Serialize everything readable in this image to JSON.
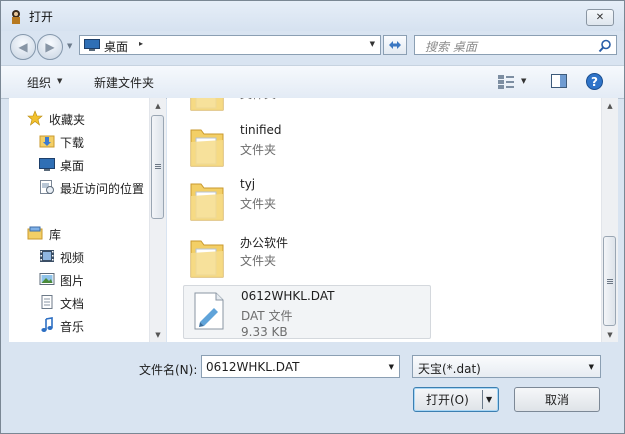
{
  "window": {
    "title": "打开",
    "close_glyph": "✕"
  },
  "nav": {
    "address": {
      "location": "桌面",
      "chevron": "▸"
    },
    "search": {
      "placeholder": "搜索 桌面"
    }
  },
  "toolbar": {
    "organize_label": "组织",
    "new_folder_label": "新建文件夹"
  },
  "sidebar": {
    "favorites_header": "收藏夹",
    "favorites": [
      {
        "label": "下载",
        "icon": "download-folder-icon"
      },
      {
        "label": "桌面",
        "icon": "desktop-icon"
      },
      {
        "label": "最近访问的位置",
        "icon": "recent-places-icon"
      }
    ],
    "libraries_header": "库",
    "libraries": [
      {
        "label": "视频",
        "icon": "video-library-icon"
      },
      {
        "label": "图片",
        "icon": "pictures-library-icon"
      },
      {
        "label": "文档",
        "icon": "documents-library-icon"
      },
      {
        "label": "音乐",
        "icon": "music-library-icon"
      }
    ]
  },
  "files": {
    "partial_type": "文件夹",
    "items": [
      {
        "name": "tinified",
        "type": "文件夹"
      },
      {
        "name": "tyj",
        "type": "文件夹"
      },
      {
        "name": "办公软件",
        "type": "文件夹"
      },
      {
        "name": "0612WHKL.DAT",
        "type": "DAT 文件",
        "size": "9.33 KB",
        "selected": true
      }
    ]
  },
  "bottom": {
    "filename_label": "文件名(N):",
    "filename_value": "0612WHKL.DAT",
    "filter_value": "天宝(*.dat)",
    "open_label": "打开(O)",
    "cancel_label": "取消"
  },
  "colors": {
    "accent": "#3c7fb1",
    "folder": "#f3cf66",
    "window_bg": "#d9e4f1"
  }
}
